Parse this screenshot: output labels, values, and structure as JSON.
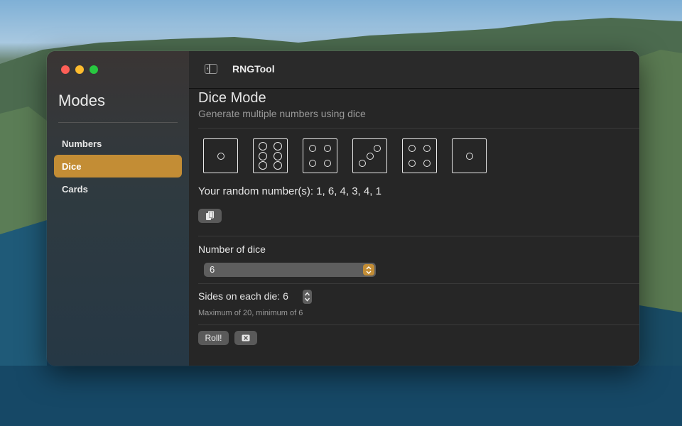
{
  "window": {
    "app_title": "RNGTool",
    "traffic_lights": {
      "close_color": "#ff5f57",
      "minimize_color": "#febc2e",
      "zoom_color": "#28c840"
    }
  },
  "sidebar": {
    "title": "Modes",
    "items": [
      {
        "label": "Numbers",
        "selected": false
      },
      {
        "label": "Dice",
        "selected": true
      },
      {
        "label": "Cards",
        "selected": false
      }
    ],
    "accent_color": "#c38d35"
  },
  "main": {
    "title": "Dice Mode",
    "subtitle": "Generate multiple numbers using dice",
    "dice_faces": [
      1,
      6,
      4,
      3,
      4,
      1
    ],
    "result_text": "Your random number(s): 1, 6, 4, 3, 4, 1",
    "copy_icon": "copy-icon",
    "number_of_dice_label": "Number of dice",
    "number_of_dice_value": "6",
    "sides_label": "Sides on each die: 6",
    "sides_hint": "Maximum of 20, minimum of 6",
    "roll_label": "Roll!",
    "clear_icon": "clear-icon"
  }
}
